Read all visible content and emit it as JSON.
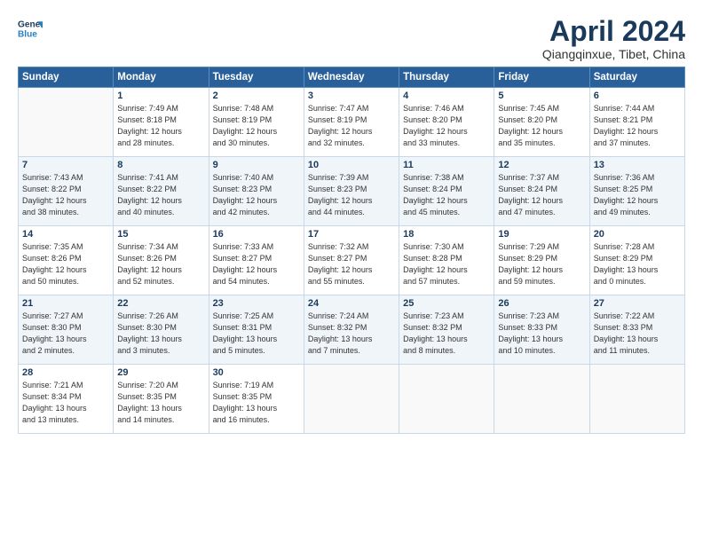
{
  "header": {
    "title": "April 2024",
    "subtitle": "Qiangqinxue, Tibet, China",
    "logo_line1": "General",
    "logo_line2": "Blue"
  },
  "columns": [
    "Sunday",
    "Monday",
    "Tuesday",
    "Wednesday",
    "Thursday",
    "Friday",
    "Saturday"
  ],
  "weeks": [
    [
      {
        "day": "",
        "info": ""
      },
      {
        "day": "1",
        "info": "Sunrise: 7:49 AM\nSunset: 8:18 PM\nDaylight: 12 hours\nand 28 minutes."
      },
      {
        "day": "2",
        "info": "Sunrise: 7:48 AM\nSunset: 8:19 PM\nDaylight: 12 hours\nand 30 minutes."
      },
      {
        "day": "3",
        "info": "Sunrise: 7:47 AM\nSunset: 8:19 PM\nDaylight: 12 hours\nand 32 minutes."
      },
      {
        "day": "4",
        "info": "Sunrise: 7:46 AM\nSunset: 8:20 PM\nDaylight: 12 hours\nand 33 minutes."
      },
      {
        "day": "5",
        "info": "Sunrise: 7:45 AM\nSunset: 8:20 PM\nDaylight: 12 hours\nand 35 minutes."
      },
      {
        "day": "6",
        "info": "Sunrise: 7:44 AM\nSunset: 8:21 PM\nDaylight: 12 hours\nand 37 minutes."
      }
    ],
    [
      {
        "day": "7",
        "info": "Sunrise: 7:43 AM\nSunset: 8:22 PM\nDaylight: 12 hours\nand 38 minutes."
      },
      {
        "day": "8",
        "info": "Sunrise: 7:41 AM\nSunset: 8:22 PM\nDaylight: 12 hours\nand 40 minutes."
      },
      {
        "day": "9",
        "info": "Sunrise: 7:40 AM\nSunset: 8:23 PM\nDaylight: 12 hours\nand 42 minutes."
      },
      {
        "day": "10",
        "info": "Sunrise: 7:39 AM\nSunset: 8:23 PM\nDaylight: 12 hours\nand 44 minutes."
      },
      {
        "day": "11",
        "info": "Sunrise: 7:38 AM\nSunset: 8:24 PM\nDaylight: 12 hours\nand 45 minutes."
      },
      {
        "day": "12",
        "info": "Sunrise: 7:37 AM\nSunset: 8:24 PM\nDaylight: 12 hours\nand 47 minutes."
      },
      {
        "day": "13",
        "info": "Sunrise: 7:36 AM\nSunset: 8:25 PM\nDaylight: 12 hours\nand 49 minutes."
      }
    ],
    [
      {
        "day": "14",
        "info": "Sunrise: 7:35 AM\nSunset: 8:26 PM\nDaylight: 12 hours\nand 50 minutes."
      },
      {
        "day": "15",
        "info": "Sunrise: 7:34 AM\nSunset: 8:26 PM\nDaylight: 12 hours\nand 52 minutes."
      },
      {
        "day": "16",
        "info": "Sunrise: 7:33 AM\nSunset: 8:27 PM\nDaylight: 12 hours\nand 54 minutes."
      },
      {
        "day": "17",
        "info": "Sunrise: 7:32 AM\nSunset: 8:27 PM\nDaylight: 12 hours\nand 55 minutes."
      },
      {
        "day": "18",
        "info": "Sunrise: 7:30 AM\nSunset: 8:28 PM\nDaylight: 12 hours\nand 57 minutes."
      },
      {
        "day": "19",
        "info": "Sunrise: 7:29 AM\nSunset: 8:29 PM\nDaylight: 12 hours\nand 59 minutes."
      },
      {
        "day": "20",
        "info": "Sunrise: 7:28 AM\nSunset: 8:29 PM\nDaylight: 13 hours\nand 0 minutes."
      }
    ],
    [
      {
        "day": "21",
        "info": "Sunrise: 7:27 AM\nSunset: 8:30 PM\nDaylight: 13 hours\nand 2 minutes."
      },
      {
        "day": "22",
        "info": "Sunrise: 7:26 AM\nSunset: 8:30 PM\nDaylight: 13 hours\nand 3 minutes."
      },
      {
        "day": "23",
        "info": "Sunrise: 7:25 AM\nSunset: 8:31 PM\nDaylight: 13 hours\nand 5 minutes."
      },
      {
        "day": "24",
        "info": "Sunrise: 7:24 AM\nSunset: 8:32 PM\nDaylight: 13 hours\nand 7 minutes."
      },
      {
        "day": "25",
        "info": "Sunrise: 7:23 AM\nSunset: 8:32 PM\nDaylight: 13 hours\nand 8 minutes."
      },
      {
        "day": "26",
        "info": "Sunrise: 7:23 AM\nSunset: 8:33 PM\nDaylight: 13 hours\nand 10 minutes."
      },
      {
        "day": "27",
        "info": "Sunrise: 7:22 AM\nSunset: 8:33 PM\nDaylight: 13 hours\nand 11 minutes."
      }
    ],
    [
      {
        "day": "28",
        "info": "Sunrise: 7:21 AM\nSunset: 8:34 PM\nDaylight: 13 hours\nand 13 minutes."
      },
      {
        "day": "29",
        "info": "Sunrise: 7:20 AM\nSunset: 8:35 PM\nDaylight: 13 hours\nand 14 minutes."
      },
      {
        "day": "30",
        "info": "Sunrise: 7:19 AM\nSunset: 8:35 PM\nDaylight: 13 hours\nand 16 minutes."
      },
      {
        "day": "",
        "info": ""
      },
      {
        "day": "",
        "info": ""
      },
      {
        "day": "",
        "info": ""
      },
      {
        "day": "",
        "info": ""
      }
    ]
  ]
}
